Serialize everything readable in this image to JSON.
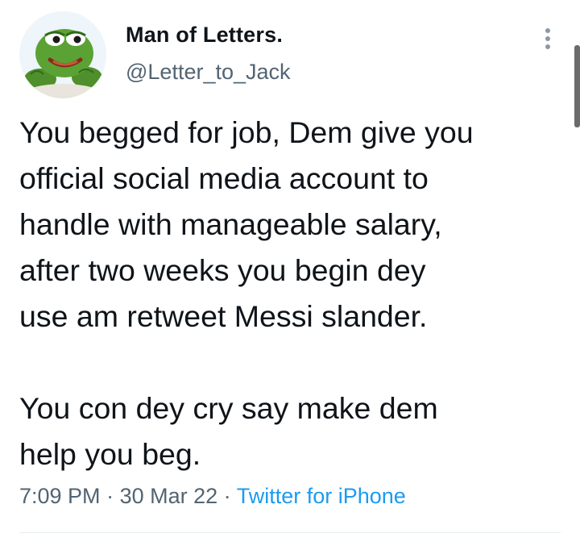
{
  "author": {
    "display_name": "Man of Letters.",
    "handle": "@Letter_to_Jack",
    "avatar_icon": "pepe-frog-avatar"
  },
  "menu_icon": "more-vertical-icon",
  "tweet": {
    "paragraph1_lines": [
      "You begged for job, Dem give you",
      "official social media account to",
      "handle with manageable salary,",
      "after two weeks you begin dey",
      "use am retweet Messi slander."
    ],
    "paragraph2_lines": [
      "You con dey cry say make dem",
      "help you beg."
    ]
  },
  "meta": {
    "time": "7:09 PM",
    "date": "30 Mar 22",
    "separator": "·",
    "source": "Twitter for iPhone"
  },
  "colors": {
    "text_primary": "#0f1419",
    "text_secondary": "#536471",
    "link": "#1d9bf0",
    "avatar_bg": "#eef5fb"
  }
}
